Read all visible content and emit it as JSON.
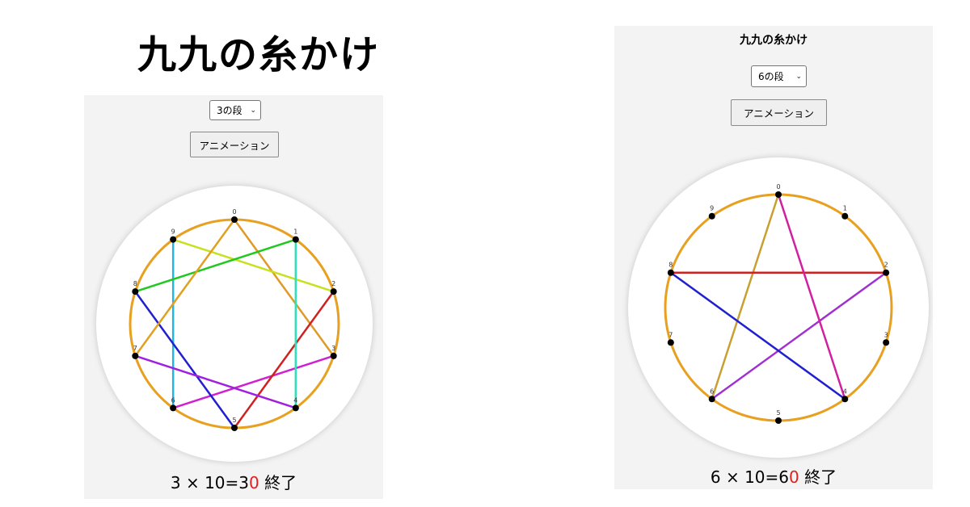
{
  "page": {
    "title": "九九の糸かけ"
  },
  "left": {
    "select_label": "3の段",
    "button_label": "アニメーション",
    "multiplier": 3,
    "status": {
      "lhs": "3",
      "times": "×",
      "rhs": "10",
      "eq": "=",
      "res_main": "3",
      "res_red": "0",
      "end": "終了"
    },
    "number_labels": [
      "0",
      "1",
      "2",
      "3",
      "4",
      "5",
      "6",
      "7",
      "8",
      "9"
    ],
    "segment_colors": [
      "#e09a28",
      "#d020d0",
      "#20b8e0",
      "#c8e020",
      "#d02020",
      "#2020d0",
      "#20c820",
      "#30e0b8",
      "#a020e0",
      "#e0a020"
    ]
  },
  "right": {
    "title": "九九の糸かけ",
    "select_label": "6の段",
    "button_label": "アニメーション",
    "multiplier": 6,
    "status": {
      "lhs": "6",
      "times": "×",
      "rhs": "10",
      "eq": "=",
      "res_main": "6",
      "res_red": "0",
      "end": "終了"
    },
    "number_labels": [
      "0",
      "1",
      "2",
      "3",
      "4",
      "5",
      "6",
      "7",
      "8",
      "9"
    ],
    "segment_colors": [
      "#c8a030",
      "#a030d0",
      "#d02020",
      "#2020d0",
      "#d020a0"
    ]
  },
  "colors": {
    "circle": "#e8a020",
    "result_red": "#e02020",
    "point": "#000000"
  }
}
